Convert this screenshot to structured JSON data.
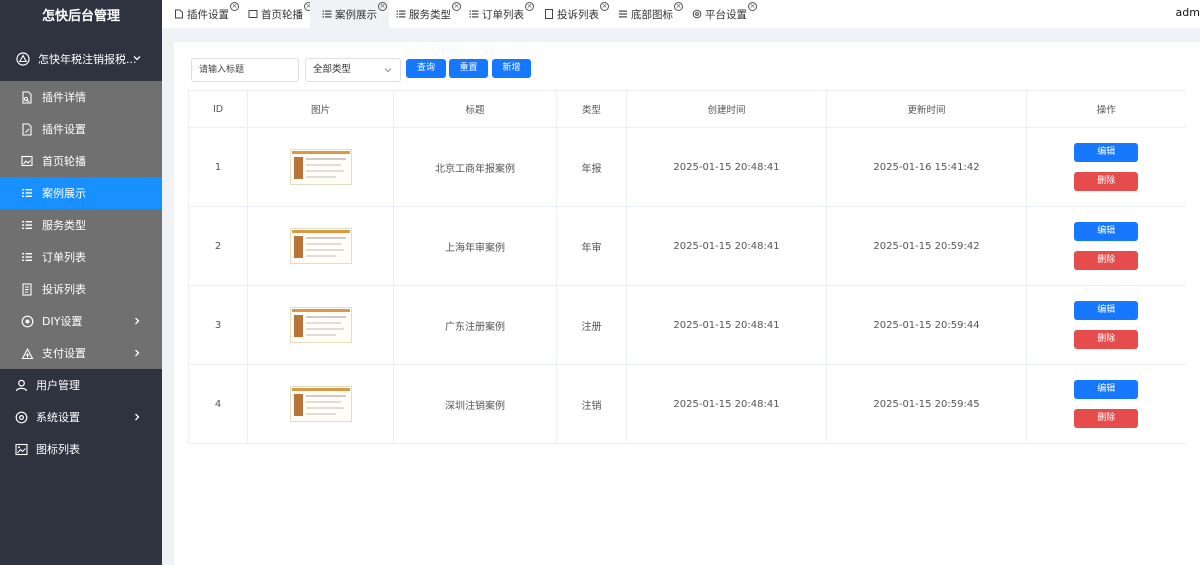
{
  "brand": "怎快后台管理",
  "sidebar": {
    "parent": {
      "label": "怎快年税注销报税...",
      "icon": "triangle-plugin-icon"
    },
    "sub_items": [
      {
        "label": "插件详情",
        "icon": "file-icon"
      },
      {
        "label": "插件设置",
        "icon": "file-edit-icon"
      },
      {
        "label": "首页轮播",
        "icon": "image-icon"
      },
      {
        "label": "案例展示",
        "icon": "list-icon",
        "active": true
      },
      {
        "label": "服务类型",
        "icon": "list-icon"
      },
      {
        "label": "订单列表",
        "icon": "list-icon"
      },
      {
        "label": "投诉列表",
        "icon": "document-icon"
      },
      {
        "label": "DIY设置",
        "icon": "circle-icon"
      },
      {
        "label": "支付设置",
        "icon": "payment-icon"
      }
    ],
    "top_items": [
      {
        "label": "用户管理",
        "icon": "user-icon"
      },
      {
        "label": "系统设置",
        "icon": "settings-icon"
      },
      {
        "label": "图标列表",
        "icon": "picture-icon"
      }
    ]
  },
  "tabs": [
    {
      "label": "插件设置"
    },
    {
      "label": "首页轮播"
    },
    {
      "label": "案例展示",
      "active": true
    },
    {
      "label": "服务类型"
    },
    {
      "label": "订单列表"
    },
    {
      "label": "投诉列表"
    },
    {
      "label": "底部图标"
    },
    {
      "label": "平台设置"
    }
  ],
  "user": "adm",
  "search": {
    "placeholder": "请输入标题",
    "select_value": "全部类型",
    "query_label": "查询",
    "reset_label": "重置",
    "add_label": "新增"
  },
  "table": {
    "headers": [
      "ID",
      "图片",
      "标题",
      "类型",
      "创建时间",
      "更新时间",
      "操作"
    ],
    "rows": [
      {
        "id": "1",
        "title": "北京工商年报案例",
        "type": "年报",
        "created": "2025-01-15 20:48:41",
        "updated": "2025-01-16 15:41:42"
      },
      {
        "id": "2",
        "title": "上海年审案例",
        "type": "年审",
        "created": "2025-01-15 20:48:41",
        "updated": "2025-01-15 20:59:42"
      },
      {
        "id": "3",
        "title": "广东注册案例",
        "type": "注册",
        "created": "2025-01-15 20:48:41",
        "updated": "2025-01-15 20:59:44"
      },
      {
        "id": "4",
        "title": "深圳注销案例",
        "type": "注销",
        "created": "2025-01-15 20:48:41",
        "updated": "2025-01-15 20:59:45"
      }
    ],
    "edit_label": "编辑",
    "delete_label": "删除"
  },
  "colors": {
    "sidebar_bg": "#2f3340",
    "submenu_bg": "#707070",
    "active": "#1890ff",
    "primary": "#1677ff",
    "danger": "#e74c4c"
  }
}
